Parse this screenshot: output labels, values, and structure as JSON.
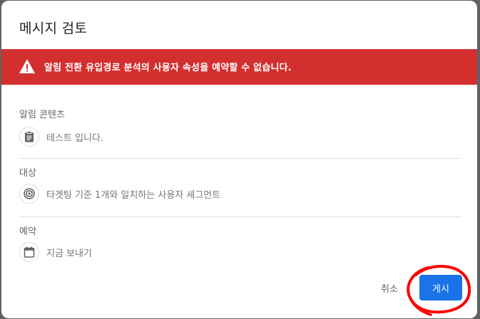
{
  "dialog": {
    "title": "메시지 검토",
    "alert": {
      "icon": "warning-icon",
      "text": "알림 전환 유입경로 분석의 사용자 속성을 예약할 수 없습니다.",
      "color": "#d32f2f"
    },
    "sections": [
      {
        "label": "알림 콘텐츠",
        "icon": "clipboard-icon",
        "value": "테스트 입니다."
      },
      {
        "label": "대상",
        "icon": "target-icon",
        "value": "타겟팅 기준 1개와 일치하는 사용자 세그먼트"
      },
      {
        "label": "예약",
        "icon": "calendar-icon",
        "value": "지금 보내기"
      }
    ],
    "actions": {
      "cancel_label": "취소",
      "publish_label": "게시",
      "primary_color": "#1a73e8"
    },
    "annotation_color": "#ff0000"
  }
}
